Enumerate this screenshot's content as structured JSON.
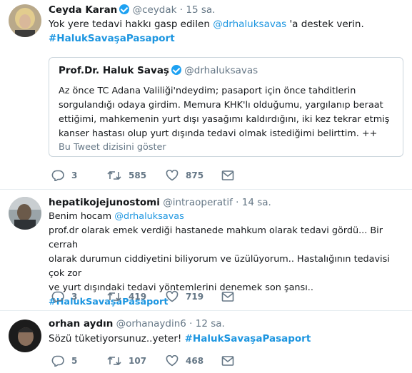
{
  "tweets": [
    {
      "name": "Ceyda Karan",
      "handle": "@ceydak",
      "time": "15 sa.",
      "text_parts": [
        "Yok yere tedavi hakkı gasp edilen ",
        "@drhaluksavas",
        " 'a destek verin."
      ],
      "hashtag": "#HalukSavaşaPasaport",
      "quote": {
        "name": "Prof.Dr. Haluk Savaş",
        "handle": "@drhaluksavas",
        "lines": [
          "Az önce TC Adana Valiliği'ndeydim; pasaport için önce tahditlerin",
          "sorgulandığı odaya girdim. Memura KHK'lı olduğumu, yargılanıp beraat",
          "ettiğimi, mahkemenin yurt dışı yasağımı kaldırdığını, iki kez tekrar etmiş",
          "kanser hastası olup yurt dışında tedavi olmak istediğimi belirttim. ++"
        ],
        "thread": "Bu Tweet dizisini göster"
      },
      "replies": "3",
      "retweets": "585",
      "likes": "875"
    },
    {
      "name": "hepatikojejunostomi",
      "handle": "@intraoperatif",
      "time": "14 sa.",
      "line1_prefix": "Benim hocam ",
      "line1_mention": "@drhaluksavas",
      "lines": [
        "prof.dr olarak emek verdiği hastanede mahkum olarak tedavi gördü... Bir cerrah",
        "olarak durumun ciddiyetini biliyorum ve üzülüyorum.. Hastalığının tedavisi çok zor",
        "ve yurt dışındaki tedavi yöntemlerini denemek son şansı.."
      ],
      "hashtag": "#HalukSavaşaPasaport",
      "replies": "3",
      "retweets": "419",
      "likes": "719"
    },
    {
      "name": "orhan aydın",
      "handle": "@orhanaydin6",
      "time": "12 sa.",
      "text": "Sözü tüketiyorsunuz..yeter! ",
      "hashtag": "#HalukSavaşaPasaport",
      "replies": "5",
      "retweets": "107",
      "likes": "468"
    }
  ],
  "separator": "·",
  "icons": [
    "reply-icon",
    "retweet-icon",
    "like-icon",
    "message-icon",
    "verified-icon"
  ],
  "colors": {
    "link": "#1b95e0",
    "verified": "#1da1f2",
    "muted": "#657786",
    "border": "#e6ecf0"
  }
}
